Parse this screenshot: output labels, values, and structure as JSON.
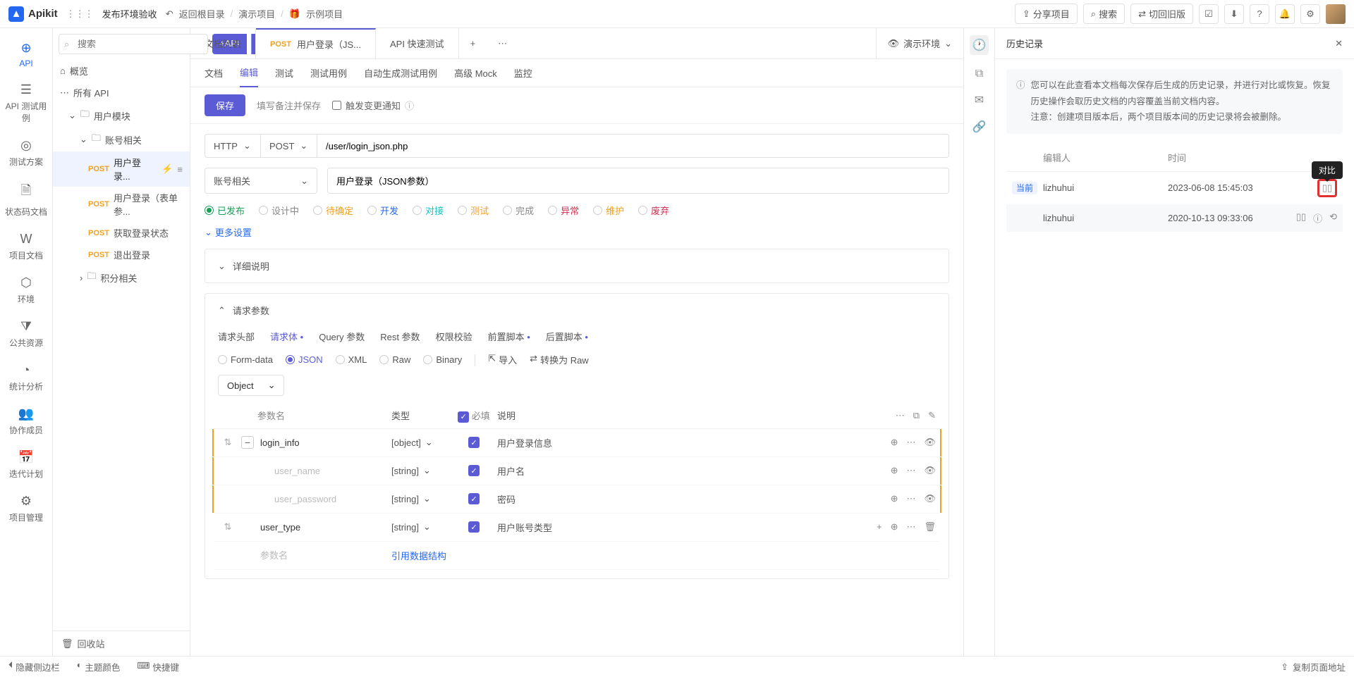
{
  "topbar": {
    "logo": "Apikit",
    "grid_label": "发布环境验收",
    "back": "返回根目录",
    "crumbs": [
      "演示项目",
      "示例项目"
    ],
    "share": "分享项目",
    "search": "搜索",
    "switch_old": "切回旧版"
  },
  "leftnav": {
    "items": [
      "API",
      "API 测试用例",
      "测试方案",
      "状态码文档",
      "项目文档",
      "环境",
      "公共资源",
      "统计分析",
      "协作成员",
      "迭代计划",
      "项目管理"
    ]
  },
  "tree": {
    "search_ph": "搜索",
    "add_api": "+API",
    "overview": "概览",
    "all_apis": "所有 API",
    "groups": {
      "user_module": "用户模块",
      "account": "账号相关",
      "points": "积分相关"
    },
    "apis": [
      {
        "method": "POST",
        "name": "用户登录..."
      },
      {
        "method": "POST",
        "name": "用户登录（表单参..."
      },
      {
        "method": "POST",
        "name": "获取登录状态"
      },
      {
        "method": "POST",
        "name": "退出登录"
      }
    ],
    "recycle": "回收站"
  },
  "tabs": {
    "list": "文档列表",
    "active": {
      "method": "POST",
      "name": "用户登录（JS..."
    },
    "quick_test": "API 快速测试",
    "env": "演示环境"
  },
  "subtabs": [
    "文档",
    "编辑",
    "测试",
    "测试用例",
    "自动生成测试用例",
    "高级 Mock",
    "监控"
  ],
  "save_row": {
    "save": "保存",
    "note": "填写备注并保存",
    "trigger": "触发变更通知"
  },
  "form": {
    "protocol": "HTTP",
    "method": "POST",
    "url": "/user/login_json.php",
    "group": "账号相关",
    "api_name": "用户登录（JSON参数）",
    "statuses": [
      "已发布",
      "设计中",
      "待确定",
      "开发",
      "对接",
      "测试",
      "完成",
      "异常",
      "维护",
      "废弃"
    ],
    "more": "更多设置"
  },
  "panels": {
    "detail": "详细说明",
    "request": "请求参数",
    "param_tabs": [
      "请求头部",
      "请求体",
      "Query 参数",
      "Rest 参数",
      "权限校验",
      "前置脚本",
      "后置脚本"
    ],
    "body_types": [
      "Form-data",
      "JSON",
      "XML",
      "Raw",
      "Binary"
    ],
    "import": "导入",
    "convert": "转换为 Raw",
    "root_type": "Object",
    "headers": {
      "name": "参数名",
      "type": "类型",
      "required": "必填",
      "desc": "说明"
    },
    "rows": [
      {
        "name": "login_info",
        "type": "[object]",
        "desc": "用户登录信息",
        "toggle": "−",
        "drag": true
      },
      {
        "name_ph": "user_name",
        "type": "[string]",
        "desc": "用户名",
        "indent": true
      },
      {
        "name_ph": "user_password",
        "type": "[string]",
        "desc": "密码",
        "indent": true
      },
      {
        "name": "user_type",
        "type": "[string]",
        "desc": "用户账号类型",
        "drag": true
      }
    ],
    "name_ph": "参数名",
    "ref_struct": "引用数据结构"
  },
  "history": {
    "title": "历史记录",
    "info": "您可以在此查看本文档每次保存后生成的历史记录，并进行对比或恢复。恢复历史操作会取历史文档的内容覆盖当前文档内容。\n注意：创建项目版本后，两个项目版本间的历史记录将会被删除。",
    "cols": {
      "editor": "编辑人",
      "time": "时间"
    },
    "rows": [
      {
        "current": "当前",
        "editor": "lizhuhui",
        "time": "2023-06-08 15:45:03"
      },
      {
        "editor": "lizhuhui",
        "time": "2020-10-13 09:33:06"
      }
    ],
    "compare_tip": "对比"
  },
  "footer": {
    "hide_sidebar": "隐藏侧边栏",
    "theme": "主题颜色",
    "shortcut": "快捷键",
    "copy_url": "复制页面地址"
  }
}
